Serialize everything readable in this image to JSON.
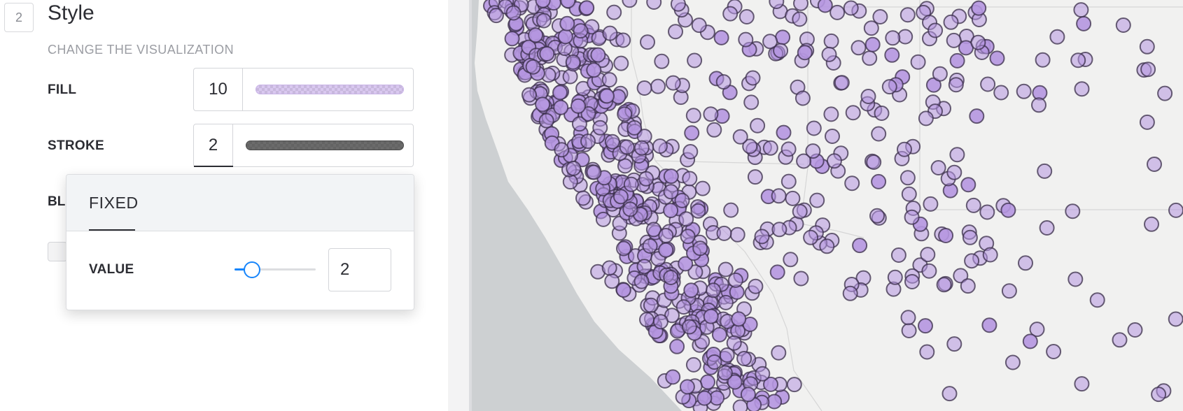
{
  "step": {
    "number": "2",
    "title": "Style",
    "subtitle": "CHANGE THE VISUALIZATION"
  },
  "fill": {
    "label": "FILL",
    "value": "10",
    "color": "#d9c8f0"
  },
  "stroke": {
    "label": "STROKE",
    "value": "2",
    "color": "#6b6b6b"
  },
  "blending": {
    "label_partial": "BL"
  },
  "popover": {
    "tab_label": "FIXED",
    "value_label": "VALUE",
    "value": "2",
    "slider_fraction": 0.1,
    "slider_color": "#1785fb"
  },
  "map": {
    "marker_fill": "#b596e0",
    "marker_stroke": "#3a2e4a",
    "ocean_color": "#cdd0d2",
    "land_color": "#f1f1f0"
  }
}
